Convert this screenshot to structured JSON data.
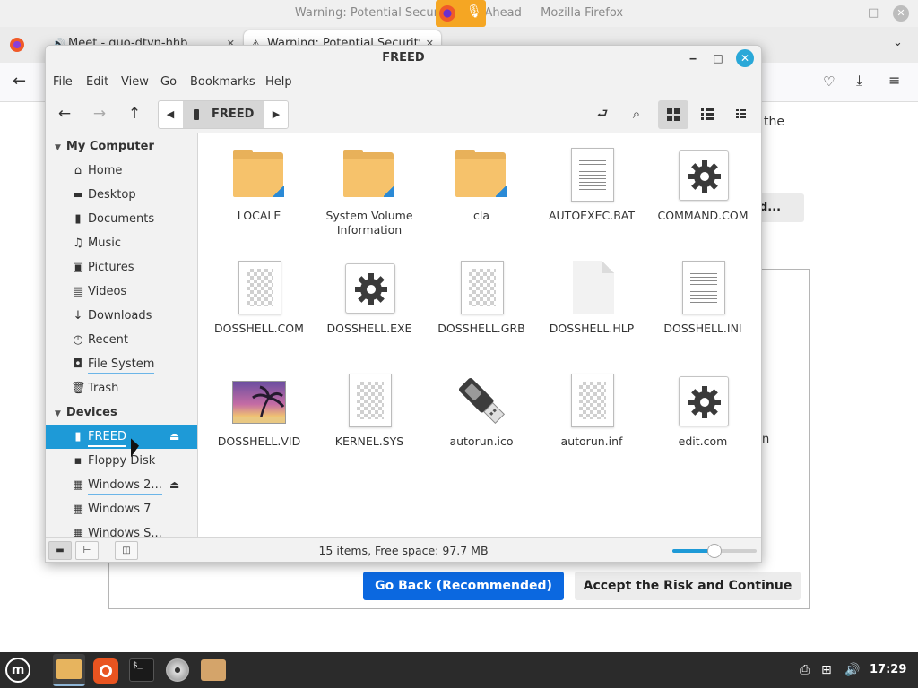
{
  "firefox": {
    "window_title": "Warning: Potential Security Risk Ahead — Mozilla Firefox",
    "tabs": [
      {
        "label": "Meet - quo-dtvn-hhb"
      },
      {
        "label": "Warning: Potential Security Risk Ahead"
      }
    ],
    "peek_the": "the",
    "peek_button": "d...",
    "peek_n": "n",
    "go_back_label": "Go Back (Recommended)",
    "accept_label": "Accept the Risk and Continue"
  },
  "nemo": {
    "title": "FREED",
    "menu": [
      "File",
      "Edit",
      "View",
      "Go",
      "Bookmarks",
      "Help"
    ],
    "path_crumb": "FREED",
    "sidebar": {
      "my_computer": "My Computer",
      "places": [
        {
          "label": "Home",
          "icon": "home-icon"
        },
        {
          "label": "Desktop",
          "icon": "desktop-icon"
        },
        {
          "label": "Documents",
          "icon": "documents-icon"
        },
        {
          "label": "Music",
          "icon": "music-icon"
        },
        {
          "label": "Pictures",
          "icon": "pictures-icon"
        },
        {
          "label": "Videos",
          "icon": "videos-icon"
        },
        {
          "label": "Downloads",
          "icon": "downloads-icon"
        },
        {
          "label": "Recent",
          "icon": "recent-icon"
        },
        {
          "label": "File System",
          "icon": "filesystem-icon"
        },
        {
          "label": "Trash",
          "icon": "trash-icon"
        }
      ],
      "devices_heading": "Devices",
      "devices": [
        {
          "label": "FREED",
          "icon": "usb-drive-icon",
          "selected": true,
          "eject": true
        },
        {
          "label": "Floppy Disk",
          "icon": "floppy-icon",
          "eject": false
        },
        {
          "label": "Windows 2...",
          "icon": "harddisk-icon",
          "eject": true
        },
        {
          "label": "Windows 7",
          "icon": "harddisk-icon",
          "eject": false
        },
        {
          "label": "Windows S...",
          "icon": "harddisk-icon",
          "eject": false
        }
      ]
    },
    "files": [
      {
        "name": "LOCALE",
        "type": "folder"
      },
      {
        "name": "System Volume Information",
        "type": "folder"
      },
      {
        "name": "cla",
        "type": "folder"
      },
      {
        "name": "AUTOEXEC.BAT",
        "type": "text"
      },
      {
        "name": "COMMAND.COM",
        "type": "executable"
      },
      {
        "name": "DOSSHELL.COM",
        "type": "binary"
      },
      {
        "name": "DOSSHELL.EXE",
        "type": "executable"
      },
      {
        "name": "DOSSHELL.GRB",
        "type": "binary"
      },
      {
        "name": "DOSSHELL.HLP",
        "type": "blank"
      },
      {
        "name": "DOSSHELL.INI",
        "type": "text"
      },
      {
        "name": "DOSSHELL.VID",
        "type": "image"
      },
      {
        "name": "KERNEL.SYS",
        "type": "binary"
      },
      {
        "name": "autorun.ico",
        "type": "usb-image"
      },
      {
        "name": "autorun.inf",
        "type": "binary"
      },
      {
        "name": "edit.com",
        "type": "executable"
      }
    ],
    "status": "15 items, Free space: 97.7 MB",
    "zoom_level": 0.5
  },
  "taskbar": {
    "clock": "17:29"
  },
  "colors": {
    "accent": "#1e9ad7",
    "folder": "#f6c26b",
    "go_back": "#0b68e0"
  }
}
